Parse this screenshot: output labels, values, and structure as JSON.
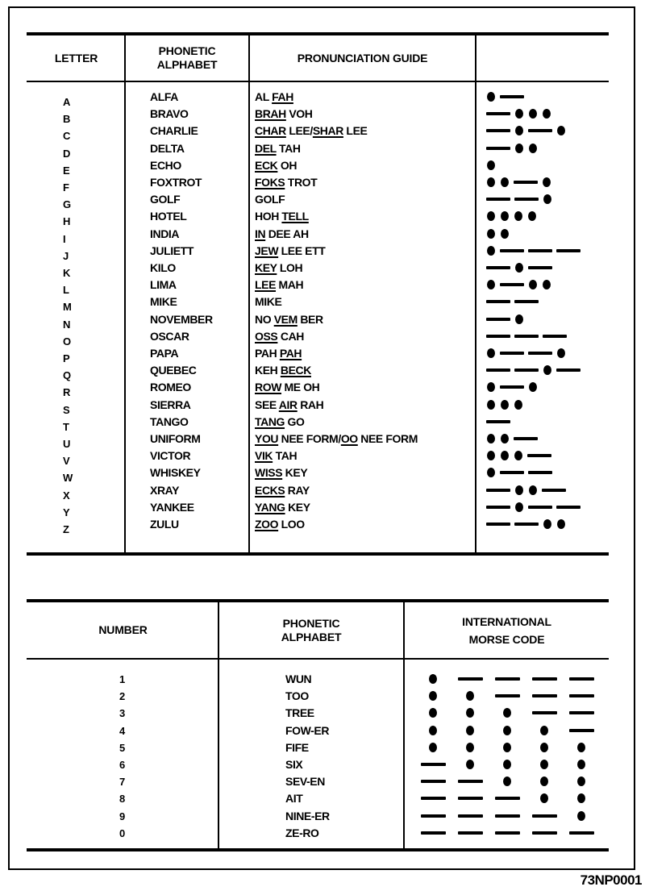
{
  "letters_table": {
    "headers": {
      "letter": "LETTER",
      "phonetic_line1": "PHONETIC",
      "phonetic_line2": "ALPHABET",
      "pronunciation": "PRONUNCIATION GUIDE",
      "morse": ""
    },
    "rows": [
      {
        "letter": "A",
        "phonetic": "ALFA",
        "pronunciation": [
          [
            "AL ",
            false
          ],
          [
            "FAH",
            true
          ]
        ],
        "morse": ".-"
      },
      {
        "letter": "B",
        "phonetic": "BRAVO",
        "pronunciation": [
          [
            "BRAH",
            true
          ],
          [
            " VOH",
            false
          ]
        ],
        "morse": "-..."
      },
      {
        "letter": "C",
        "phonetic": "CHARLIE",
        "pronunciation": [
          [
            "CHAR",
            true
          ],
          [
            " LEE/",
            false
          ],
          [
            "SHAR",
            true
          ],
          [
            " LEE",
            false
          ]
        ],
        "morse": "-.-."
      },
      {
        "letter": "D",
        "phonetic": "DELTA",
        "pronunciation": [
          [
            "DEL",
            true
          ],
          [
            " TAH",
            false
          ]
        ],
        "morse": "-.."
      },
      {
        "letter": "E",
        "phonetic": "ECHO",
        "pronunciation": [
          [
            "ECK",
            true
          ],
          [
            " OH",
            false
          ]
        ],
        "morse": "."
      },
      {
        "letter": "F",
        "phonetic": "FOXTROT",
        "pronunciation": [
          [
            "FOKS",
            true
          ],
          [
            " TROT",
            false
          ]
        ],
        "morse": "..-."
      },
      {
        "letter": "G",
        "phonetic": "GOLF",
        "pronunciation": [
          [
            "GOLF",
            false
          ]
        ],
        "morse": "--."
      },
      {
        "letter": "H",
        "phonetic": "HOTEL",
        "pronunciation": [
          [
            "HOH ",
            false
          ],
          [
            "TELL",
            true
          ]
        ],
        "morse": "...."
      },
      {
        "letter": "I",
        "phonetic": "INDIA",
        "pronunciation": [
          [
            "IN",
            true
          ],
          [
            " DEE AH",
            false
          ]
        ],
        "morse": ".."
      },
      {
        "letter": "J",
        "phonetic": "JULIETT",
        "pronunciation": [
          [
            "JEW",
            true
          ],
          [
            " LEE ETT",
            false
          ]
        ],
        "morse": ".---"
      },
      {
        "letter": "K",
        "phonetic": "KILO",
        "pronunciation": [
          [
            "KEY",
            true
          ],
          [
            " LOH",
            false
          ]
        ],
        "morse": "-.-"
      },
      {
        "letter": "L",
        "phonetic": "LIMA",
        "pronunciation": [
          [
            "LEE",
            true
          ],
          [
            " MAH",
            false
          ]
        ],
        "morse": ".-.."
      },
      {
        "letter": "M",
        "phonetic": "MIKE",
        "pronunciation": [
          [
            "MIKE",
            false
          ]
        ],
        "morse": "--"
      },
      {
        "letter": "N",
        "phonetic": "NOVEMBER",
        "pronunciation": [
          [
            "NO ",
            false
          ],
          [
            "VEM",
            true
          ],
          [
            " BER",
            false
          ]
        ],
        "morse": "-."
      },
      {
        "letter": "O",
        "phonetic": "OSCAR",
        "pronunciation": [
          [
            "OSS",
            true
          ],
          [
            " CAH",
            false
          ]
        ],
        "morse": "---"
      },
      {
        "letter": "P",
        "phonetic": "PAPA",
        "pronunciation": [
          [
            "PAH ",
            false
          ],
          [
            "PAH",
            true
          ]
        ],
        "morse": ".--."
      },
      {
        "letter": "Q",
        "phonetic": "QUEBEC",
        "pronunciation": [
          [
            "KEH ",
            false
          ],
          [
            "BECK",
            true
          ]
        ],
        "morse": "--.-"
      },
      {
        "letter": "R",
        "phonetic": "ROMEO",
        "pronunciation": [
          [
            "ROW",
            true
          ],
          [
            " ME OH",
            false
          ]
        ],
        "morse": ".-."
      },
      {
        "letter": "S",
        "phonetic": "SIERRA",
        "pronunciation": [
          [
            "SEE ",
            false
          ],
          [
            "AIR",
            true
          ],
          [
            " RAH",
            false
          ]
        ],
        "morse": "..."
      },
      {
        "letter": "T",
        "phonetic": "TANGO",
        "pronunciation": [
          [
            "TANG",
            true
          ],
          [
            " GO",
            false
          ]
        ],
        "morse": "-"
      },
      {
        "letter": "U",
        "phonetic": "UNIFORM",
        "pronunciation": [
          [
            "YOU",
            true
          ],
          [
            " NEE FORM/",
            false
          ],
          [
            "OO",
            true
          ],
          [
            " NEE FORM",
            false
          ]
        ],
        "morse": "..-"
      },
      {
        "letter": "V",
        "phonetic": "VICTOR",
        "pronunciation": [
          [
            "VIK",
            true
          ],
          [
            " TAH",
            false
          ]
        ],
        "morse": "...-"
      },
      {
        "letter": "W",
        "phonetic": "WHISKEY",
        "pronunciation": [
          [
            "WISS",
            true
          ],
          [
            " KEY",
            false
          ]
        ],
        "morse": ".--"
      },
      {
        "letter": "X",
        "phonetic": "XRAY",
        "pronunciation": [
          [
            "ECKS",
            true
          ],
          [
            " RAY",
            false
          ]
        ],
        "morse": "-..-"
      },
      {
        "letter": "Y",
        "phonetic": "YANKEE",
        "pronunciation": [
          [
            "YANG",
            true
          ],
          [
            " KEY",
            false
          ]
        ],
        "morse": "-.--"
      },
      {
        "letter": "Z",
        "phonetic": "ZULU",
        "pronunciation": [
          [
            "ZOO",
            true
          ],
          [
            " LOO",
            false
          ]
        ],
        "morse": "--.."
      }
    ]
  },
  "numbers_table": {
    "headers": {
      "number": "NUMBER",
      "phonetic_line1": "PHONETIC",
      "phonetic_line2": "ALPHABET",
      "morse_line1": "INTERNATIONAL",
      "morse_line2": "MORSE CODE"
    },
    "rows": [
      {
        "number": "1",
        "phonetic": "WUN",
        "morse": ".----"
      },
      {
        "number": "2",
        "phonetic": "TOO",
        "morse": "..---"
      },
      {
        "number": "3",
        "phonetic": "TREE",
        "morse": "...--"
      },
      {
        "number": "4",
        "phonetic": "FOW-ER",
        "morse": "....-"
      },
      {
        "number": "5",
        "phonetic": "FIFE",
        "morse": "....."
      },
      {
        "number": "6",
        "phonetic": "SIX",
        "morse": "-...."
      },
      {
        "number": "7",
        "phonetic": "SEV-EN",
        "morse": "--..."
      },
      {
        "number": "8",
        "phonetic": "AIT",
        "morse": "---.."
      },
      {
        "number": "9",
        "phonetic": "NINE-ER",
        "morse": "----."
      },
      {
        "number": "0",
        "phonetic": "ZE-RO",
        "morse": "-----"
      }
    ]
  },
  "caption": "73NP0001"
}
